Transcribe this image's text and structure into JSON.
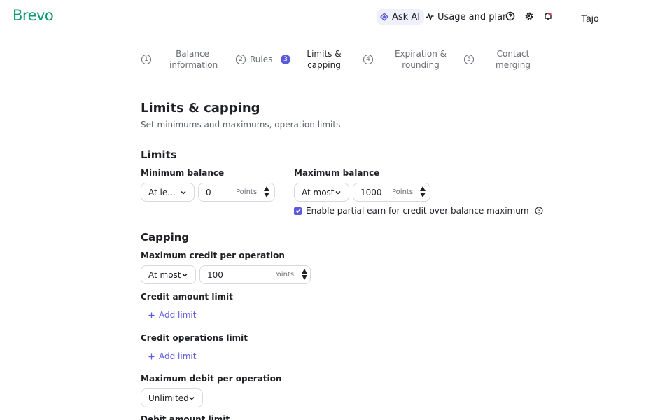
{
  "header": {
    "logo": "Brevo",
    "ask_ai": "Ask AI",
    "usage": "Usage and plan",
    "user": "Tajo"
  },
  "stepper": {
    "steps": [
      {
        "num": "1",
        "label_line1": "Balance",
        "label_line2": "information"
      },
      {
        "num": "2",
        "label_line1": "Rules",
        "label_line2": ""
      },
      {
        "num": "3",
        "label_line1": "Limits &",
        "label_line2": "capping"
      },
      {
        "num": "4",
        "label_line1": "Expiration &",
        "label_line2": "rounding"
      },
      {
        "num": "5",
        "label_line1": "Contact",
        "label_line2": "merging"
      }
    ]
  },
  "page": {
    "title": "Limits & capping",
    "subtitle": "Set minimums and maximums, operation limits"
  },
  "limits": {
    "title": "Limits",
    "min_label": "Minimum balance",
    "min_select": "At le...",
    "min_value": "0",
    "min_unit": "Points",
    "max_label": "Maximum balance",
    "max_select": "At most",
    "max_value": "1000",
    "max_unit": "Points",
    "checkbox_label": "Enable partial earn for credit over balance maximum"
  },
  "capping": {
    "title": "Capping",
    "max_credit_label": "Maximum credit per operation",
    "max_credit_select": "At most",
    "max_credit_value": "100",
    "max_credit_unit": "Points",
    "credit_amount_label": "Credit amount limit",
    "credit_amount_add": "Add limit",
    "credit_ops_label": "Credit operations limit",
    "credit_ops_add": "Add limit",
    "max_debit_label": "Maximum debit per operation",
    "max_debit_select": "Unlimited",
    "debit_amount_label": "Debit amount limit"
  },
  "colors": {
    "brand": "#0b996e",
    "accent": "#5a5adb",
    "text": "#1f2024",
    "muted": "#6b6e77"
  }
}
